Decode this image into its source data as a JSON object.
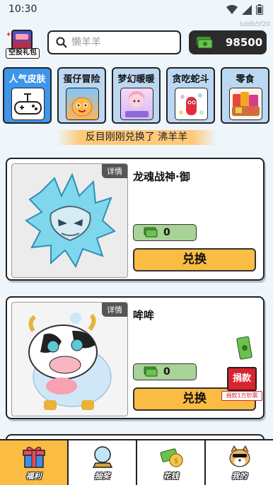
{
  "status": {
    "time": "10:30",
    "device_id": "bddb5f20"
  },
  "header": {
    "gift_pack_label": "空投礼包",
    "search_placeholder": "懒羊羊",
    "balance": "98500"
  },
  "categories": [
    {
      "label": "人气皮肤",
      "icon": "gamepad-icon",
      "active": true
    },
    {
      "label": "蛋仔冒险",
      "icon": "eggy-party-icon",
      "active": false
    },
    {
      "label": "梦幻暖暖",
      "icon": "nikki-icon",
      "active": false
    },
    {
      "label": "贪吃蛇斗",
      "icon": "snake-icon",
      "active": false
    },
    {
      "label": "零食",
      "icon": "snacks-icon",
      "active": false
    }
  ],
  "notice": "反目刚刚兑换了 沸羊羊",
  "products": [
    {
      "name": "龙魂战神·御",
      "detail_label": "详情",
      "price": "0",
      "redeem_label": "兑换"
    },
    {
      "name": "哞哞",
      "detail_label": "详情",
      "price": "0",
      "redeem_label": "兑换"
    }
  ],
  "donate": {
    "label": "捐款",
    "sub_label": "捐款1万钞票"
  },
  "bottom_nav": [
    {
      "label": "福利",
      "icon": "gift-box-icon",
      "active": true
    },
    {
      "label": "抽奖",
      "icon": "crystal-ball-icon",
      "active": false
    },
    {
      "label": "花钱",
      "icon": "money-bag-icon",
      "active": false
    },
    {
      "label": "我的",
      "icon": "shiba-dog-icon",
      "active": false
    }
  ],
  "colors": {
    "background": "#eef5fb",
    "accent_blue": "#3e95ea",
    "button_yellow": "#fbbc44",
    "price_green": "#a8d296",
    "donate_red": "#d8242e"
  }
}
